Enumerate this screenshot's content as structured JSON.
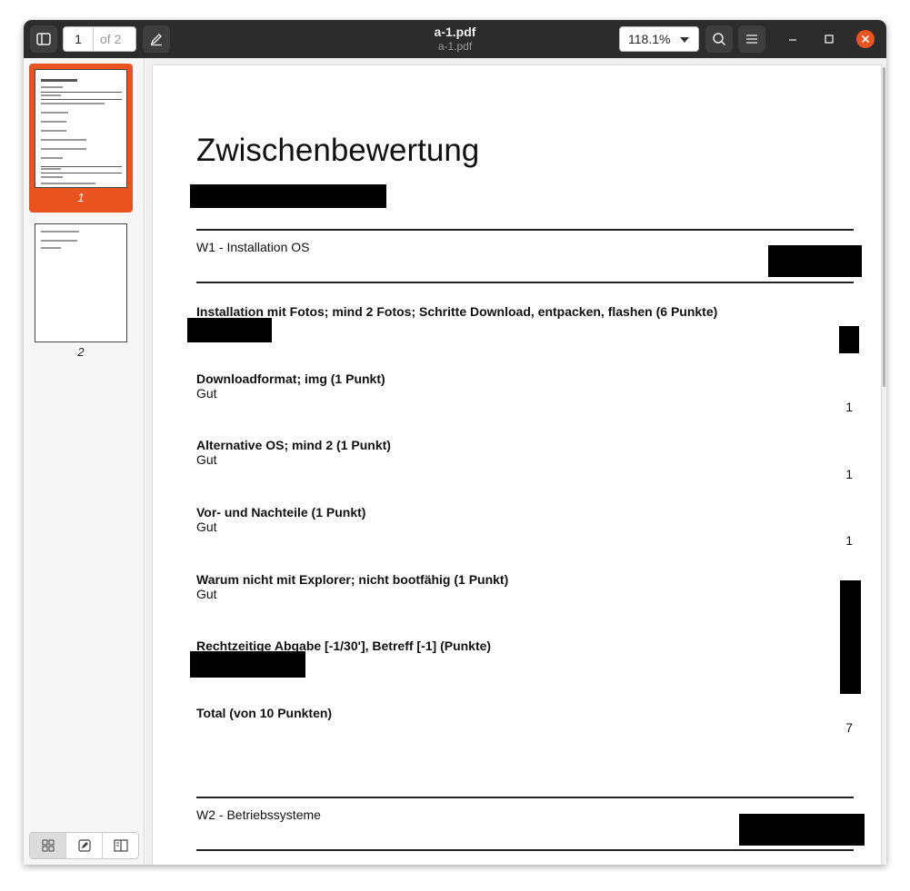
{
  "window": {
    "title": "a-1.pdf",
    "subtitle": "a-1.pdf"
  },
  "toolbar": {
    "current_page": "1",
    "page_total": "of 2",
    "zoom": "118.1%"
  },
  "sidebar": {
    "thumbnails": [
      {
        "label": "1",
        "selected": true
      },
      {
        "label": "2",
        "selected": false
      }
    ]
  },
  "document": {
    "title": "Zwischenbewertung",
    "sections": [
      {
        "label": "W1 - Installation OS"
      },
      {
        "label": "W2 - Betriebssysteme"
      }
    ],
    "items": [
      {
        "question": "Installation mit Fotos; mind 2 Fotos; Schritte Download, entpacken, flashen (6 Punkte)",
        "answer": "",
        "score": ""
      },
      {
        "question": "Downloadformat; img (1 Punkt)",
        "answer": "Gut",
        "score": "1"
      },
      {
        "question": "Alternative OS; mind 2 (1 Punkt)",
        "answer": "Gut",
        "score": "1"
      },
      {
        "question": "Vor- und Nachteile (1 Punkt)",
        "answer": "Gut",
        "score": "1"
      },
      {
        "question": "Warum nicht mit Explorer; nicht bootfähig (1 Punkt)",
        "answer": "Gut",
        "score": ""
      },
      {
        "question": "Rechtzeitige Abgabe [-1/30'], Betreff [-1] (Punkte)",
        "answer": "",
        "score": ""
      },
      {
        "question": "Total (von 10 Punkten)",
        "answer": "",
        "score": "7"
      }
    ]
  },
  "colors": {
    "accent": "#e95420",
    "titlebar": "#2c2c2c"
  }
}
